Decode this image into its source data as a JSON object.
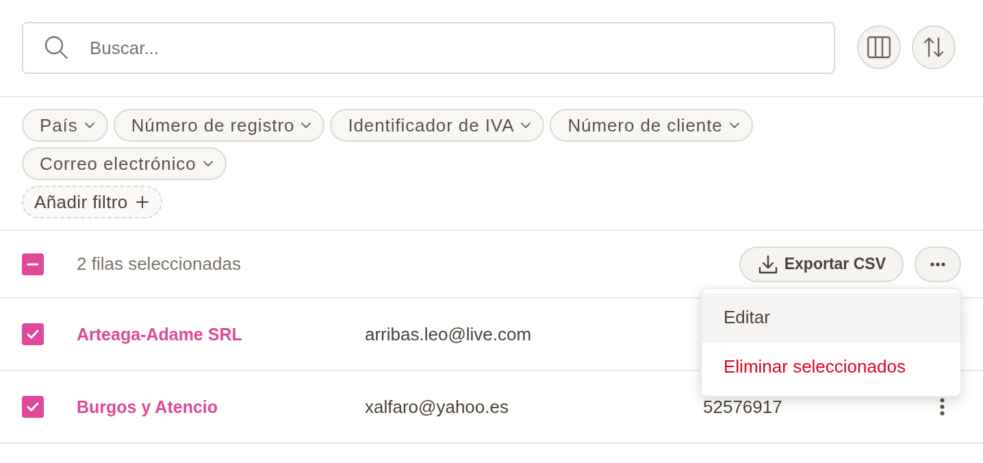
{
  "search": {
    "placeholder": "Buscar..."
  },
  "filters": [
    {
      "kind": "dropdown",
      "label": "País"
    },
    {
      "kind": "dropdown",
      "label": "Número de registro"
    },
    {
      "kind": "dropdown",
      "label": "Identificador de IVA"
    },
    {
      "kind": "dropdown",
      "label": "Número de cliente"
    },
    {
      "kind": "dropdown",
      "label": "Correo electrónico"
    },
    {
      "kind": "add",
      "label": "Añadir filtro"
    }
  ],
  "selection": {
    "indeterminate": true,
    "label": "2 filas seleccionadas"
  },
  "actions": [
    {
      "kind": "export",
      "label": "Exportar CSV"
    },
    {
      "kind": "more"
    }
  ],
  "menu": {
    "items": [
      {
        "kind": "default",
        "label": "Editar",
        "highlighted": true
      },
      {
        "kind": "danger",
        "label": "Eliminar seleccionados",
        "highlighted": false
      }
    ]
  },
  "rows": [
    {
      "checked": true,
      "name": "Arteaga-Adame SRL",
      "email": "arribas.leo@live.com"
    },
    {
      "checked": true,
      "name": "Burgos y Atencio",
      "email": "xalfaro@yahoo.es",
      "number": "52576917",
      "actions_menu": true
    }
  ]
}
